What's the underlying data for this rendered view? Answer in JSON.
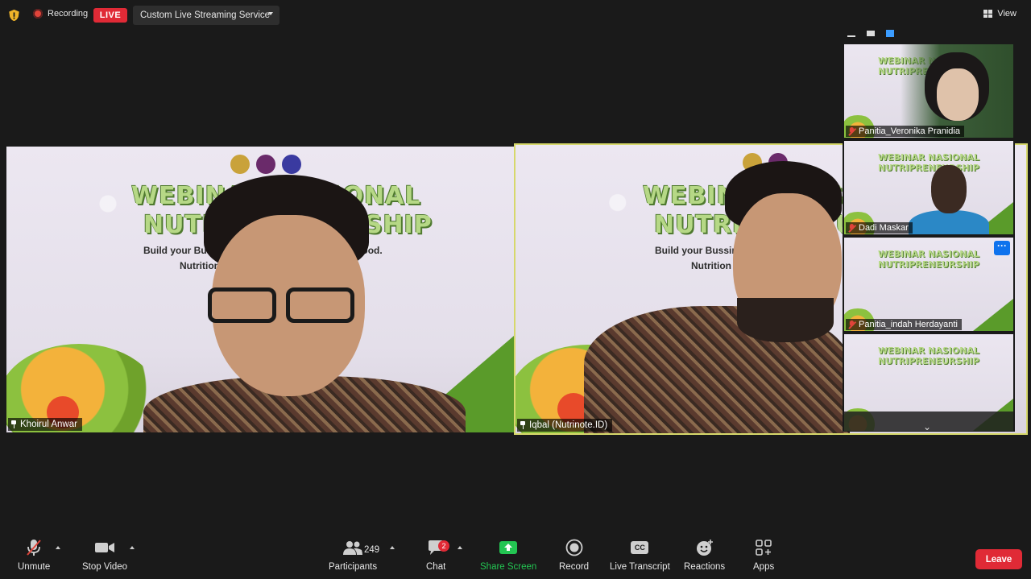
{
  "topbar": {
    "recording_label": "Recording",
    "live_badge": "LIVE",
    "streaming_service": "Custom Live Streaming Service",
    "view_label": "View"
  },
  "main_tiles": [
    {
      "participant_name": "Khoirul Anwar",
      "slide_title": "WEBINAR NASIONAL",
      "slide_title2": "NUTRIPRENEURSHIP",
      "slide_subtitle": "Build your Bussiness Idea in Soy-Based Local food.",
      "slide_subtitle2": "Nutrition and Health for Millennials"
    },
    {
      "participant_name": "Iqbal (Nutrinote.ID)",
      "slide_title": "WEBINAR NASIONAL",
      "slide_title2": "NUTRIPRENEURSHIP",
      "slide_subtitle": "Build your Bussiness Idea",
      "slide_subtitle2": "Nutrition"
    }
  ],
  "gallery": {
    "thumb_title": "WEBINAR NASIONAL",
    "thumb_title2": "NUTRIPRENEURSHIP",
    "participants": [
      {
        "name": "Panitia_Veronika Pranidia"
      },
      {
        "name": "Dadi Maskar"
      },
      {
        "name": "Panitia_indah Herdayanti"
      },
      {
        "name": ""
      }
    ],
    "more_label": "···",
    "scroll_glyph": "⌄"
  },
  "toolbar": {
    "unmute": "Unmute",
    "stop_video": "Stop Video",
    "participants": "Participants",
    "participant_count": "249",
    "chat": "Chat",
    "chat_badge": "2",
    "share_screen": "Share Screen",
    "record": "Record",
    "live_transcript": "Live Transcript",
    "cc_icon_text": "CC",
    "reactions": "Reactions",
    "apps": "Apps",
    "leave": "Leave"
  },
  "colors": {
    "background": "#1a1a1a",
    "live_red": "#e02a36",
    "share_green": "#23c552",
    "active_speaker_border": "#d6d86b",
    "more_blue": "#0e72ed"
  }
}
